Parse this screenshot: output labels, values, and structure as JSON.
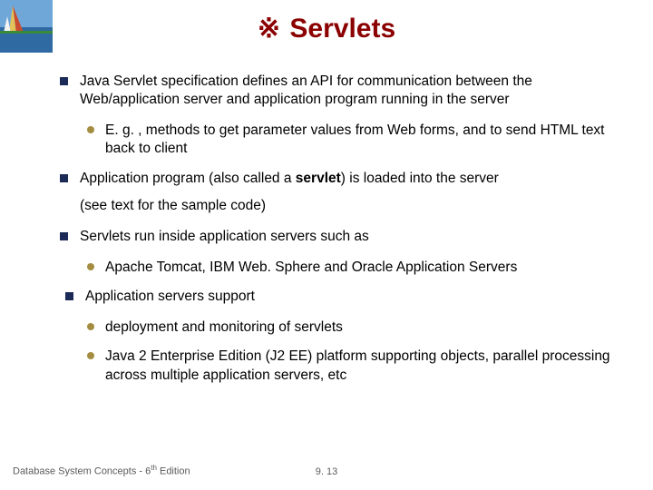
{
  "header": {
    "glyph": "※",
    "title": "Servlets"
  },
  "bullets": {
    "b1": "Java Servlet specification defines an API for communication between the Web/application server and application program running in the server",
    "b1a": "E. g. , methods to get parameter values from Web forms, and to send HTML text back to client",
    "b2_pre": "Application program (also called a ",
    "b2_kw": "servlet",
    "b2_post": ") is loaded into the server",
    "b2_note": "(see text for the sample code)",
    "b3": "Servlets run inside application servers such as",
    "b3a": "Apache Tomcat, IBM Web. Sphere and Oracle Application Servers",
    "b4": "Application servers support",
    "b4a": "deployment and monitoring of servlets",
    "b4b": "Java 2 Enterprise Edition (J2 EE) platform supporting objects, parallel processing across multiple application servers, etc"
  },
  "footer": {
    "text_pre": "Database System Concepts - 6",
    "text_sup": "th",
    "text_post": " Edition",
    "page": "9. 13"
  }
}
